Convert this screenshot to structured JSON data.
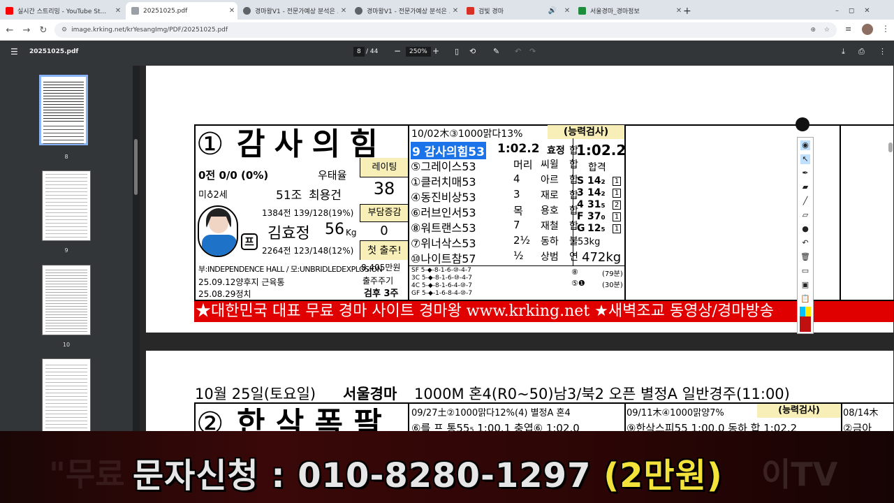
{
  "tabs": [
    {
      "title": "실시간 스트리밍 - YouTube St...",
      "favicon_color": "#ff0000",
      "active": false
    },
    {
      "title": "20251025.pdf",
      "favicon_color": "#9aa0a6",
      "active": true
    },
    {
      "title": "경마왕V1 - 전문가예상 분석은 ...",
      "favicon_color": "#5f6368",
      "active": false
    },
    {
      "title": "경마왕V1 - 전문가예상 분석은 ...",
      "favicon_color": "#5f6368",
      "active": false
    },
    {
      "title": "검빛 경마",
      "favicon_color": "#d93025",
      "active": false
    },
    {
      "title": "서울경마_경마정보",
      "favicon_color": "#1e8e3e",
      "active": false
    }
  ],
  "address": {
    "url": "image.krking.net/krYesangImg/PDF/20251025.pdf"
  },
  "pdf_toolbar": {
    "filename": "20251025.pdf",
    "page_current": "8",
    "page_total": "/ 44",
    "zoom": "250%",
    "minus": "−",
    "plus": "+"
  },
  "sidebar": {
    "thumbnails": [
      {
        "label": "8",
        "selected": true
      },
      {
        "label": "9",
        "selected": false
      },
      {
        "label": "10",
        "selected": false
      }
    ]
  },
  "page1": {
    "horse_number": "①",
    "horse_name": "감 사 의 힘",
    "record": "0전 0/0 (0%)",
    "win_rate_label": "우태율",
    "rating_label": "레이팅",
    "rating": "38",
    "origin": "미♁2세",
    "owner_group": "51조",
    "trainer": "최용건",
    "trainer_stats": "1384전 139/128(19%)",
    "burden_label": "부담증감",
    "burden": "0",
    "jockey": "김효정",
    "jockey_weight": "56",
    "jockey_unit": "Kg",
    "jockey_badge": "프",
    "jockey_stats": "2264전 123/148(12%)",
    "first_start": "첫 출주!",
    "pedigree": "부:INDEPENDENCE HALL / 모:UNBRIDLEDEXPLOSION",
    "prize": "8,405만원",
    "training_1": "25.09.12양후지 근육통",
    "training_2": "25.08.29정치",
    "cycle_label": "출주주기",
    "cycle": "검후 3주",
    "race_header": "10/02木③1000맑다13%",
    "race_type": "(능력검사)",
    "winner_row": "9 감사의힘53",
    "winner_time": "1:02.2",
    "winner_jockey": "효정",
    "winner_result": "합",
    "results": [
      {
        "name": "⑤그레이스53",
        "margin": "머리",
        "jockey": "씨윌",
        "result": "합"
      },
      {
        "name": "①클러치매53",
        "margin": "4",
        "jockey": "아르",
        "result": "합"
      },
      {
        "name": "④동진비상53",
        "margin": "3",
        "jockey": "재로",
        "result": "합"
      },
      {
        "name": "⑥러브인서53",
        "margin": "목",
        "jockey": "용호",
        "result": "합"
      },
      {
        "name": "⑧워트랜스53",
        "margin": "7",
        "jockey": "재철",
        "result": "합"
      },
      {
        "name": "⑦위너삭스53",
        "margin": "2½",
        "jockey": "동하",
        "result": "불"
      },
      {
        "name": "⑩나이트참57",
        "margin": "½",
        "jockey": "상범",
        "result": "연"
      }
    ],
    "pace_lines": [
      "SF 5-◆-8-1-6-⑩-4-7",
      "3C 5-◆-8-1-6-⑩-4-7",
      "4C 5-◆-8-1-6-4-⑩-7",
      "GF 5-◆-1-6-8-4-⑩-7"
    ],
    "pace_right_1": "⑧",
    "pace_right_1b": "(79분)",
    "pace_right_2": "⑤❶",
    "pace_right_2b": "(30분)",
    "summary_time": "1:02.2",
    "summary_result": "합격",
    "sectionals": [
      {
        "key": "S",
        "value": "14₂",
        "rank": "1"
      },
      {
        "key": "3",
        "value": "14₂",
        "rank": "1"
      },
      {
        "key": "4",
        "value": "31₅",
        "rank": "2"
      },
      {
        "key": "F",
        "value": "37₀",
        "rank": "1"
      },
      {
        "key": "G",
        "value": "12₅",
        "rank": "1"
      }
    ],
    "body_weight_1": "53kg",
    "body_weight_2": "472kg",
    "banner": "★대한민국 대표 무료 경마 사이트 경마왕 www.krking.net     ★새벽조교 동영상/경마방송"
  },
  "page2": {
    "race_title": "10월 25일(토요일)",
    "venue": "서울경마",
    "race_info": "1000M 혼4(R0~50)남3/북2 오픈 별정A 일반경주(11:00)",
    "horse_number": "②",
    "horse_name": "한 삭 폭 팔",
    "race_a_header": "09/27土②1000맑다12%(4) 별정A 혼4",
    "race_a_row": "⑥를 프 통55₅ 1:00.1 충엽⑥ 1:02.0",
    "race_b_header": "09/11木④1000맑양7%",
    "race_b_type": "(능력검사)",
    "race_b_row": "⑨한삭스피55 1:00.0 동하 합 1:02.2",
    "race_c_header": "08/14木",
    "race_c_row": "②금아"
  },
  "overlay": {
    "ghost_left": "\"무료",
    "text": "문자신청 : 010-8280-1297",
    "price": "(2만원)",
    "ghost_right": "이TV"
  }
}
